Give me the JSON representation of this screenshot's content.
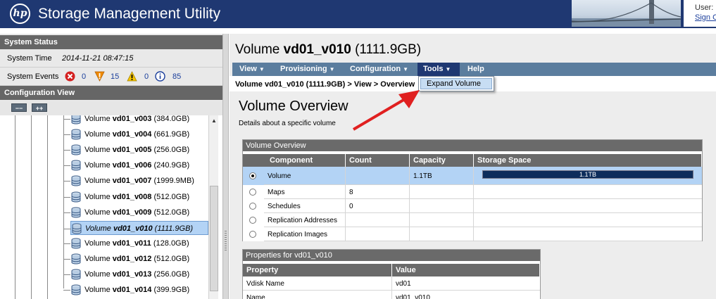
{
  "header": {
    "logo_text": "hp",
    "app_title": "Storage Management Utility",
    "user_label": "User:",
    "signout_label": "Sign O"
  },
  "system_status": {
    "title": "System Status",
    "time_label": "System Time",
    "time_value": "2014-11-21 08:47:15",
    "events_label": "System Events",
    "events": [
      {
        "icon": "error-icon",
        "count": "0",
        "color": "#d42020"
      },
      {
        "icon": "critical-icon",
        "count": "15",
        "color": "#f08a00"
      },
      {
        "icon": "warning-icon",
        "count": "0",
        "color": "#f5c400"
      },
      {
        "icon": "info-icon",
        "count": "85",
        "color": "#1a3e9b"
      }
    ]
  },
  "config_view": {
    "title": "Configuration View",
    "collapse_label": "−−",
    "expand_label": "++",
    "tree_items": [
      {
        "label": "Volume vd01_v003 (384.0GB)",
        "name": "Volume ",
        "id": "vd01_v003",
        "size": " (384.0GB)"
      },
      {
        "label": "Volume vd01_v004 (661.9GB)",
        "name": "Volume ",
        "id": "vd01_v004",
        "size": " (661.9GB)"
      },
      {
        "label": "Volume vd01_v005 (256.0GB)",
        "name": "Volume ",
        "id": "vd01_v005",
        "size": " (256.0GB)"
      },
      {
        "label": "Volume vd01_v006 (240.9GB)",
        "name": "Volume ",
        "id": "vd01_v006",
        "size": " (240.9GB)"
      },
      {
        "label": "Volume vd01_v007 (1999.9MB)",
        "name": "Volume ",
        "id": "vd01_v007",
        "size": " (1999.9MB)"
      },
      {
        "label": "Volume vd01_v008 (512.0GB)",
        "name": "Volume ",
        "id": "vd01_v008",
        "size": " (512.0GB)"
      },
      {
        "label": "Volume vd01_v009 (512.0GB)",
        "name": "Volume ",
        "id": "vd01_v009",
        "size": " (512.0GB)"
      },
      {
        "label": "Volume vd01_v010 (1111.9GB)",
        "name": "Volume ",
        "id": "vd01_v010",
        "size": " (1111.9GB)"
      },
      {
        "label": "Volume vd01_v011 (128.0GB)",
        "name": "Volume ",
        "id": "vd01_v011",
        "size": " (128.0GB)"
      },
      {
        "label": "Volume vd01_v012 (512.0GB)",
        "name": "Volume ",
        "id": "vd01_v012",
        "size": " (512.0GB)"
      },
      {
        "label": "Volume vd01_v013 (256.0GB)",
        "name": "Volume ",
        "id": "vd01_v013",
        "size": " (256.0GB)"
      },
      {
        "label": "Volume vd01_v014 (399.9GB)",
        "name": "Volume ",
        "id": "vd01_v014",
        "size": " (399.9GB)"
      }
    ],
    "selected_id": "vd01_v010"
  },
  "main": {
    "title_prefix": "Volume ",
    "title_name": "vd01_v010",
    "title_size": " (1111.9GB)",
    "menus": [
      {
        "label": "View"
      },
      {
        "label": "Provisioning"
      },
      {
        "label": "Configuration"
      },
      {
        "label": "Tools"
      },
      {
        "label": "Help"
      }
    ],
    "active_menu": "Tools",
    "dropdown_item": "Expand Volume",
    "breadcrumb": "Volume vd01_v010 (1111.9GB) > View > Overview",
    "overview_title": "Volume Overview",
    "overview_subtitle": "Details about a specific volume"
  },
  "overview_table": {
    "title": "Volume Overview",
    "columns": [
      "Component",
      "Count",
      "Capacity",
      "Storage Space"
    ],
    "rows": [
      {
        "component": "Volume",
        "count": "",
        "capacity": "1.1TB",
        "bar_label": "1.1TB",
        "selected": true
      },
      {
        "component": "Maps",
        "count": "8",
        "capacity": "",
        "bar_label": "",
        "selected": false
      },
      {
        "component": "Schedules",
        "count": "0",
        "capacity": "",
        "bar_label": "",
        "selected": false
      },
      {
        "component": "Replication Addresses",
        "count": "",
        "capacity": "",
        "bar_label": "",
        "selected": false
      },
      {
        "component": "Replication Images",
        "count": "",
        "capacity": "",
        "bar_label": "",
        "selected": false
      }
    ]
  },
  "properties_table": {
    "title": "Properties for vd01_v010",
    "columns": [
      "Property",
      "Value"
    ],
    "rows": [
      {
        "property": "Vdisk Name",
        "value": "vd01"
      },
      {
        "property": "Name",
        "value": "vd01_v010"
      }
    ]
  },
  "colors": {
    "header_bg": "#1f3872",
    "menubar_bg": "#5b7d9e",
    "selection_bg": "#b3d3f5",
    "arrow": "#e02020"
  }
}
